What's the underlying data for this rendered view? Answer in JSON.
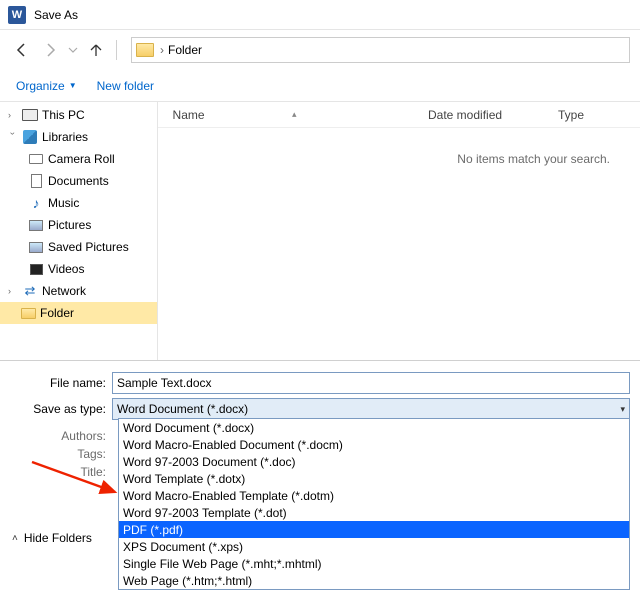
{
  "window": {
    "title": "Save As",
    "app_icon_letter": "W"
  },
  "nav": {
    "back_enabled": true,
    "forward_enabled": false,
    "up_enabled": true
  },
  "breadcrumb": {
    "current": "Folder"
  },
  "toolbar": {
    "organize": "Organize",
    "new_folder": "New folder"
  },
  "tree": {
    "this_pc": "This PC",
    "libraries": "Libraries",
    "camera_roll": "Camera Roll",
    "documents": "Documents",
    "music": "Music",
    "pictures": "Pictures",
    "saved_pictures": "Saved Pictures",
    "videos": "Videos",
    "network": "Network",
    "folder": "Folder"
  },
  "list": {
    "col_name": "Name",
    "col_date": "Date modified",
    "col_type": "Type",
    "empty": "No items match your search."
  },
  "fields": {
    "filename_label": "File name:",
    "filename_value": "Sample Text.docx",
    "saveastype_label": "Save as type:",
    "saveastype_value": "Word Document (*.docx)",
    "authors_label": "Authors:",
    "tags_label": "Tags:",
    "title_label": "Title:"
  },
  "type_options": [
    "Word Document (*.docx)",
    "Word Macro-Enabled Document (*.docm)",
    "Word 97-2003 Document (*.doc)",
    "Word Template (*.dotx)",
    "Word Macro-Enabled Template (*.dotm)",
    "Word 97-2003 Template (*.dot)",
    "PDF (*.pdf)",
    "XPS Document (*.xps)",
    "Single File Web Page (*.mht;*.mhtml)",
    "Web Page (*.htm;*.html)"
  ],
  "highlighted_option_index": 6,
  "hide_folders": "Hide Folders"
}
